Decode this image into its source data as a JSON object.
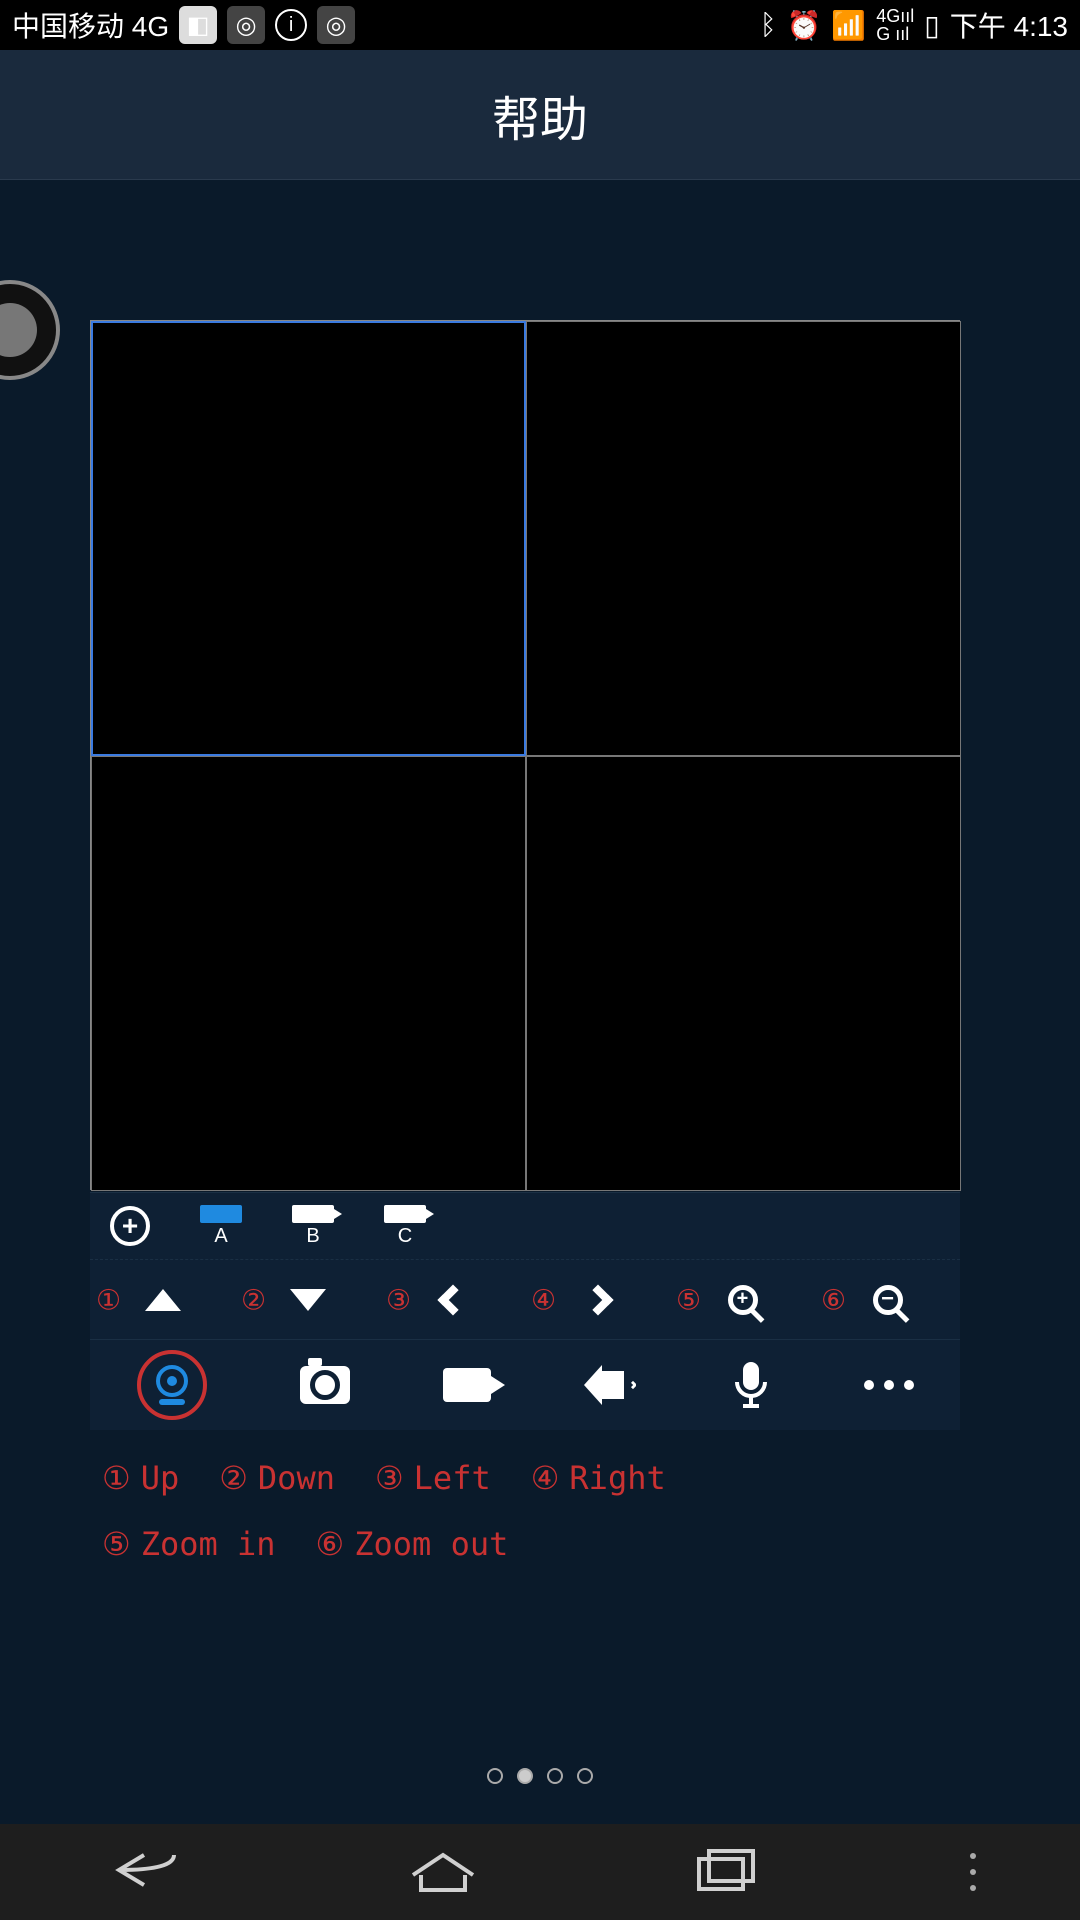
{
  "statusbar": {
    "carrier": "中国移动 4G",
    "time": "下午 4:13",
    "signal_label": "4G"
  },
  "titlebar": {
    "title": "帮助"
  },
  "devices": {
    "add_label": "+",
    "a": "A",
    "b": "B",
    "c": "C"
  },
  "ptz_numbers": {
    "n1": "①",
    "n2": "②",
    "n3": "③",
    "n4": "④",
    "n5": "⑤",
    "n6": "⑥"
  },
  "legend": {
    "l1_num": "①",
    "l1_text": "Up",
    "l2_num": "②",
    "l2_text": "Down",
    "l3_num": "③",
    "l3_text": "Left",
    "l4_num": "④",
    "l4_text": "Right",
    "l5_num": "⑤",
    "l5_text": "Zoom in",
    "l6_num": "⑥",
    "l6_text": "Zoom out"
  },
  "pagination": {
    "total": 4,
    "active_index": 1
  }
}
